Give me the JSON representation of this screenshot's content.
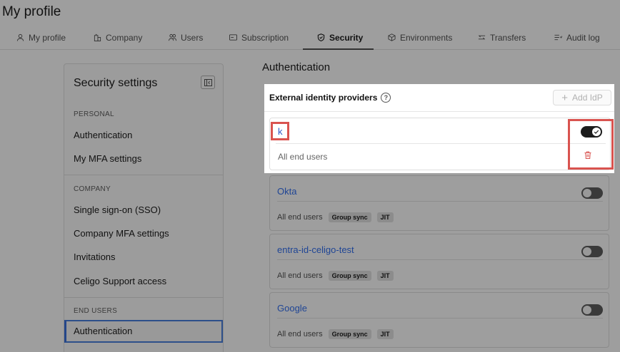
{
  "page": {
    "title": "My profile"
  },
  "tabs": [
    {
      "label": "My profile",
      "icon": "user-icon"
    },
    {
      "label": "Company",
      "icon": "building-icon"
    },
    {
      "label": "Users",
      "icon": "users-icon"
    },
    {
      "label": "Subscription",
      "icon": "card-icon"
    },
    {
      "label": "Security",
      "icon": "shield-icon",
      "active": true
    },
    {
      "label": "Environments",
      "icon": "cube-icon"
    },
    {
      "label": "Transfers",
      "icon": "transfer-icon"
    },
    {
      "label": "Audit log",
      "icon": "list-icon"
    }
  ],
  "sidebar": {
    "title": "Security settings",
    "sections": [
      {
        "label": "PERSONAL",
        "items": [
          "Authentication",
          "My MFA settings"
        ]
      },
      {
        "label": "COMPANY",
        "items": [
          "Single sign-on (SSO)",
          "Company MFA settings",
          "Invitations",
          "Celigo Support access"
        ]
      },
      {
        "label": "END USERS",
        "items": [
          "Authentication"
        ]
      }
    ]
  },
  "main": {
    "heading": "Authentication",
    "panel": {
      "title": "External identity providers",
      "add_button": "Add IdP",
      "highlighted_idp": {
        "name": "k",
        "scope": "All end users",
        "enabled": true
      }
    },
    "idps": [
      {
        "name": "Okta",
        "scope": "All end users",
        "tags": [
          "Group sync",
          "JIT"
        ],
        "enabled": false
      },
      {
        "name": "entra-id-celigo-test",
        "scope": "All end users",
        "tags": [
          "Group sync",
          "JIT"
        ],
        "enabled": false
      },
      {
        "name": "Google",
        "scope": "All end users",
        "tags": [
          "Group sync",
          "JIT"
        ],
        "enabled": false
      }
    ]
  },
  "colors": {
    "link": "#2b58c8",
    "highlight": "#d9534f",
    "danger": "#d9534f",
    "active_nav": "#24468a"
  }
}
